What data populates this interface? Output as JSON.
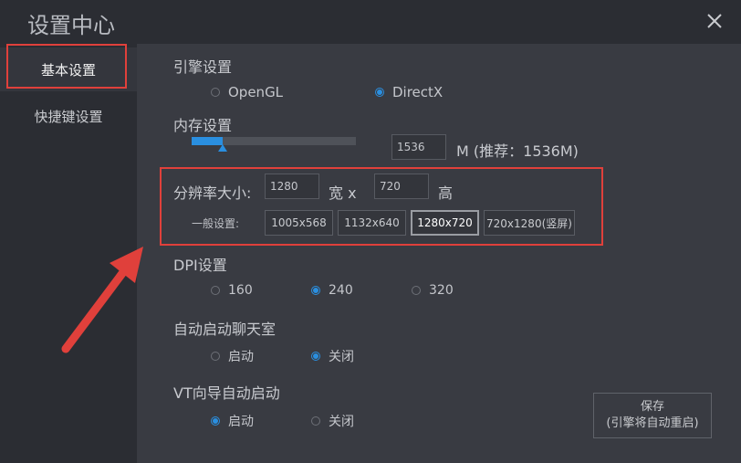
{
  "window": {
    "title": "设置中心",
    "close_icon": "close-icon"
  },
  "sidebar": {
    "items": [
      {
        "label": "基本设置",
        "active": true
      },
      {
        "label": "快捷键设置",
        "active": false
      }
    ]
  },
  "engine": {
    "label": "引擎设置",
    "options": [
      {
        "label": "OpenGL",
        "selected": false
      },
      {
        "label": "DirectX",
        "selected": true
      }
    ]
  },
  "memory": {
    "label": "内存设置",
    "value": "1536",
    "unit_hint": "M (推荐：1536M)",
    "level_fraction": 0.19
  },
  "resolution": {
    "label": "分辨率大小:",
    "width": "1280",
    "width_suffix": "宽 x",
    "height": "720",
    "height_suffix": "高",
    "presets_label": "一般设置:",
    "presets": [
      {
        "label": "1005x568",
        "selected": false
      },
      {
        "label": "1132x640",
        "selected": false
      },
      {
        "label": "1280x720",
        "selected": true
      },
      {
        "label": "720x1280(竖屏)",
        "selected": false
      }
    ]
  },
  "dpi": {
    "label": "DPI设置",
    "options": [
      {
        "label": "160",
        "selected": false
      },
      {
        "label": "240",
        "selected": true
      },
      {
        "label": "320",
        "selected": false
      }
    ]
  },
  "chatroom": {
    "label": "自动启动聊天室",
    "options": [
      {
        "label": "启动",
        "selected": false
      },
      {
        "label": "关闭",
        "selected": true
      }
    ]
  },
  "vt": {
    "label": "VT向导自动启动",
    "options": [
      {
        "label": "启动",
        "selected": true
      },
      {
        "label": "关闭",
        "selected": false
      }
    ]
  },
  "save": {
    "line1": "保存",
    "line2": "(引擎将自动重启)"
  },
  "colors": {
    "accent": "#2a8fe0",
    "highlight": "#e0403b",
    "background": "#393b42",
    "sidebar": "#2b2d33"
  }
}
